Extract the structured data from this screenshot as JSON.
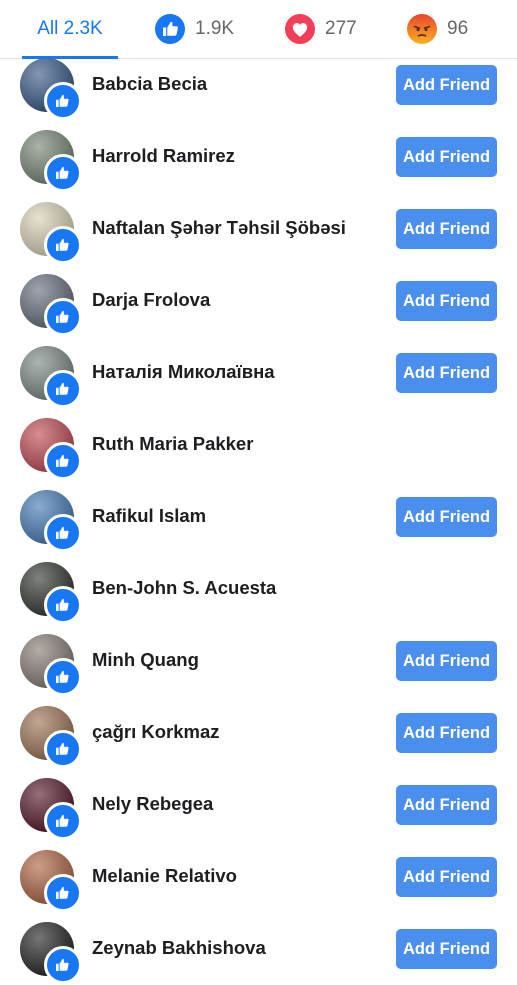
{
  "tabs": [
    {
      "label": "All 2.3K",
      "icon": "none",
      "active": true
    },
    {
      "label": "1.9K",
      "icon": "like-reaction-icon",
      "active": false
    },
    {
      "label": "277",
      "icon": "love-reaction-icon",
      "active": false
    },
    {
      "label": "96",
      "icon": "angry-reaction-icon",
      "active": false
    }
  ],
  "add_friend_label": "Add Friend",
  "people": [
    {
      "name": "Babcia Becia",
      "add_friend": true,
      "avatar_color": "#3f5f8a"
    },
    {
      "name": "Harrold Ramirez",
      "add_friend": true,
      "avatar_color": "#7a8a78"
    },
    {
      "name": "Naftalan Şəhər Təhsil Şöbəsi",
      "add_friend": true,
      "avatar_color": "#d9d2b8"
    },
    {
      "name": "Darja Frolova",
      "add_friend": true,
      "avatar_color": "#6b7480"
    },
    {
      "name": "Наталія Миколаївна",
      "add_friend": true,
      "avatar_color": "#7f8c86"
    },
    {
      "name": "Ruth Maria Pakker",
      "add_friend": false,
      "avatar_color": "#c0505a"
    },
    {
      "name": "Rafikul Islam",
      "add_friend": true,
      "avatar_color": "#4d7fb8"
    },
    {
      "name": "Ben-John S. Acuesta",
      "add_friend": false,
      "avatar_color": "#3a3d36"
    },
    {
      "name": "Minh Quang",
      "add_friend": true,
      "avatar_color": "#8a7f78"
    },
    {
      "name": "çağrı Korkmaz",
      "add_friend": true,
      "avatar_color": "#a0785a"
    },
    {
      "name": "Nely Rebegea",
      "add_friend": true,
      "avatar_color": "#5a2030"
    },
    {
      "name": "Melanie Relativo",
      "add_friend": true,
      "avatar_color": "#b06a4a"
    },
    {
      "name": "Zeynab Bakhishova",
      "add_friend": true,
      "avatar_color": "#2b2b2b"
    }
  ],
  "colors": {
    "accent": "#1877f2",
    "button": "#4a8fee",
    "love": "#f33e58",
    "angry": "#f07b22"
  }
}
